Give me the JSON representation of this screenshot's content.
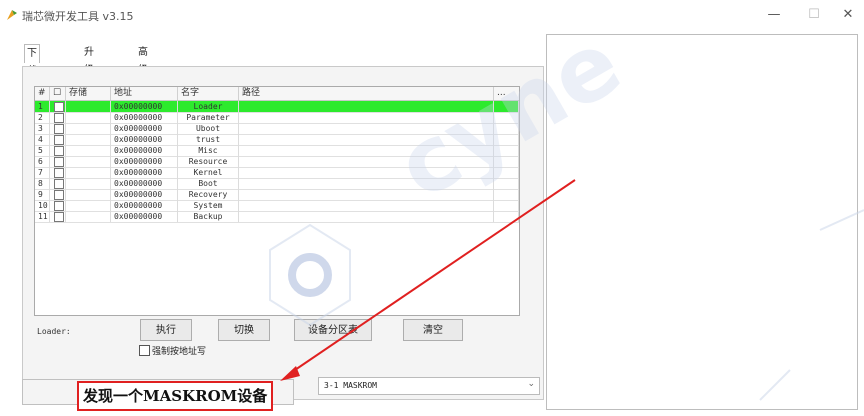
{
  "window": {
    "title": "瑞芯微开发工具 v3.15",
    "minimize": "—",
    "maximize": "☐",
    "close": "✕"
  },
  "tabs": [
    {
      "label": "下载镜像",
      "active": true
    },
    {
      "label": "升级固件",
      "active": false
    },
    {
      "label": "高级功能",
      "active": false
    }
  ],
  "table": {
    "headers": {
      "num": "#",
      "check": "☐",
      "storage": "存储",
      "address": "地址",
      "name": "名字",
      "path": "路径",
      "more": "..."
    },
    "rows": [
      {
        "num": "1",
        "address": "0x00000000",
        "name": "Loader"
      },
      {
        "num": "2",
        "address": "0x00000000",
        "name": "Parameter"
      },
      {
        "num": "3",
        "address": "0x00000000",
        "name": "Uboot"
      },
      {
        "num": "4",
        "address": "0x00000000",
        "name": "trust"
      },
      {
        "num": "5",
        "address": "0x00000000",
        "name": "Misc"
      },
      {
        "num": "6",
        "address": "0x00000000",
        "name": "Resource"
      },
      {
        "num": "7",
        "address": "0x00000000",
        "name": "Kernel"
      },
      {
        "num": "8",
        "address": "0x00000000",
        "name": "Boot"
      },
      {
        "num": "9",
        "address": "0x00000000",
        "name": "Recovery"
      },
      {
        "num": "10",
        "address": "0x00000000",
        "name": "System"
      },
      {
        "num": "11",
        "address": "0x00000000",
        "name": "Backup"
      }
    ]
  },
  "loader_label": "Loader:",
  "buttons": {
    "run": "执行",
    "switch": "切换",
    "partition_table": "设备分区表",
    "clear": "清空"
  },
  "force_write_label": "强制按地址写",
  "status_message": "发现一个MASKROM设备",
  "device_select": {
    "value": "3-1  MASKROM"
  },
  "colors": {
    "selected_row": "#2dea2d",
    "arrow": "#e02020"
  }
}
